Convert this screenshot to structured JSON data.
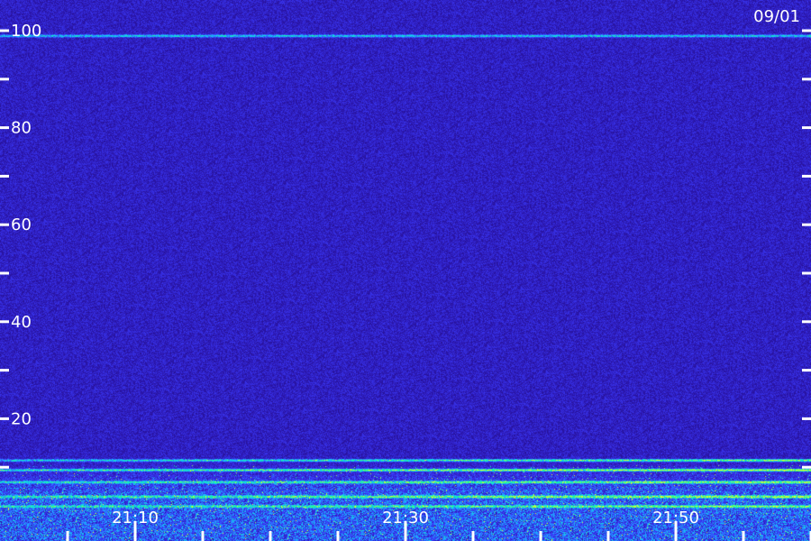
{
  "chart_data": {
    "type": "heatmap",
    "title": "",
    "date": "09/01",
    "xlabel": "",
    "ylabel": "",
    "ylim": [
      0,
      100
    ],
    "y_ticks_major": [
      20,
      40,
      60,
      80,
      100
    ],
    "y_tick_labels": [
      "20",
      "40",
      "60",
      "80",
      "100"
    ],
    "y_ticks_minor": [
      10,
      30,
      50,
      70,
      90
    ],
    "x_ticks_major": [
      "21:10",
      "21:30",
      "21:50"
    ],
    "x_tick_labels": [
      "21:10",
      "21:30",
      "21:50"
    ],
    "x_ticks_minor": [
      "21:05",
      "21:15",
      "21:20",
      "21:25",
      "21:35",
      "21:40",
      "21:45",
      "21:55",
      "22:00"
    ],
    "xlim": [
      "21:00",
      "22:00"
    ],
    "grid": false,
    "colormap": [
      "#180a4a",
      "#2a14a8",
      "#3c3cff",
      "#14c8ff",
      "#14ff96",
      "#e6ff28"
    ],
    "background_level": "low",
    "features": [
      {
        "kind": "band",
        "y": 99,
        "intensity": 0.55
      },
      {
        "kind": "band",
        "y": 11.5,
        "intensity": 0.9
      },
      {
        "kind": "band",
        "y": 9.5,
        "intensity": 1.0
      },
      {
        "kind": "band",
        "y": 7,
        "intensity": 0.85
      },
      {
        "kind": "band",
        "y": 4,
        "intensity": 0.8
      },
      {
        "kind": "band",
        "y": 2,
        "intensity": 0.7
      }
    ]
  }
}
